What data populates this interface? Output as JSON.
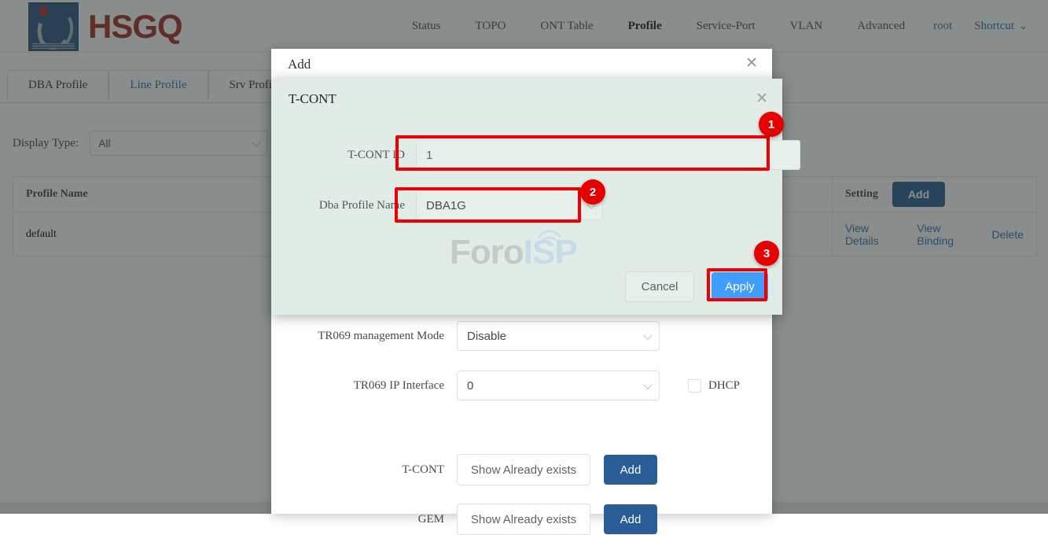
{
  "header": {
    "brand": "HSGQ",
    "logo_icon": "hsgq-logo-icon",
    "nav": [
      {
        "label": "Status",
        "active": false,
        "style": "plain"
      },
      {
        "label": "TOPO",
        "active": false,
        "style": "plain"
      },
      {
        "label": "ONT Table",
        "active": false,
        "style": "plain"
      },
      {
        "label": "Profile",
        "active": true,
        "style": "plain"
      },
      {
        "label": "Service-Port",
        "active": false,
        "style": "plain"
      },
      {
        "label": "VLAN",
        "active": false,
        "style": "plain"
      },
      {
        "label": "Advanced",
        "active": false,
        "style": "plain"
      }
    ],
    "user": "root",
    "shortcut": "Shortcut",
    "shortcut_caret": "chevron-down-icon"
  },
  "tabs": [
    {
      "label": "DBA Profile",
      "active": false
    },
    {
      "label": "Line Profile",
      "active": true
    },
    {
      "label": "Srv Profile",
      "active": false
    }
  ],
  "filter": {
    "label": "Display Type:",
    "value": "All"
  },
  "table": {
    "columns": [
      "Profile Name",
      "Setting"
    ],
    "header_add_button": "Add",
    "rows": [
      {
        "profile_name": "default",
        "actions": [
          "View Details",
          "View Binding",
          "Delete"
        ]
      }
    ]
  },
  "add_dialog": {
    "title": "Add",
    "close_icon": "close-icon",
    "fields": [
      {
        "label": "TR069 management Mode",
        "value": "Disable",
        "type": "select"
      },
      {
        "label": "TR069 IP Interface",
        "value": "0",
        "type": "select",
        "checkbox_label": "DHCP",
        "checkbox_checked": false
      },
      {
        "label": "T-CONT",
        "value": "Show Already exists",
        "type": "button",
        "add_label": "Add"
      },
      {
        "label": "GEM",
        "value": "Show Already exists",
        "type": "button",
        "add_label": "Add"
      }
    ]
  },
  "tcont_dialog": {
    "title": "T-CONT",
    "close_icon": "close-icon",
    "tcont_id_label": "T-CONT ID",
    "tcont_id_value": "1",
    "dba_label": "Dba Profile Name",
    "dba_value": "DBA1G",
    "cancel_label": "Cancel",
    "apply_label": "Apply"
  },
  "watermark": {
    "text_primary": "Foro",
    "text_secondary": "ISP"
  },
  "annotations": [
    {
      "number": "1",
      "target": "tcont-id-input"
    },
    {
      "number": "2",
      "target": "dba-profile-select"
    },
    {
      "number": "3",
      "target": "apply-button"
    }
  ],
  "colors": {
    "brand_red": "#a32a22",
    "accent_blue": "#2f6fb3",
    "button_blue": "#2a5d96",
    "apply_blue": "#409eff",
    "annotation_red": "#e60000",
    "dialog_bg": "#e2ece7"
  }
}
